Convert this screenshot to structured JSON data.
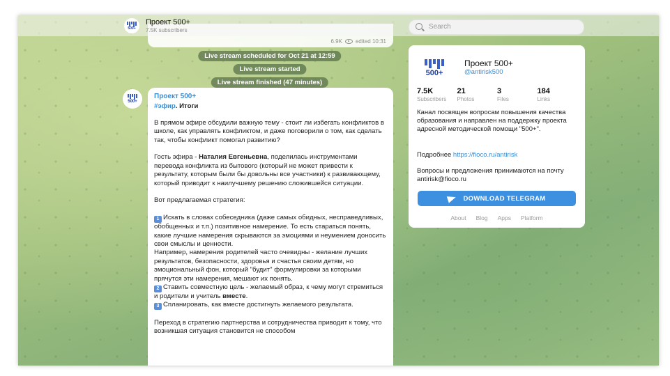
{
  "colors": {
    "accent": "#3a8dd4",
    "button": "#3d8fe0",
    "pill_bg": "#556e46"
  },
  "header": {
    "channel_title": "Проект 500+",
    "channel_subtitle": "7.5K subscribers",
    "search_placeholder": "Search"
  },
  "logo": {
    "text": "500+"
  },
  "previous_message": {
    "views": "6.9K",
    "edited": "edited 10:31"
  },
  "service_messages": [
    "Live stream scheduled for Oct 21 at 12:59",
    "Live stream started",
    "Live stream finished (47 minutes)"
  ],
  "post": {
    "author": "Проект 500+",
    "hashtag": "#эфир",
    "headline_rest": ". Итоги",
    "p1": "В прямом эфире обсудили важную тему - стоит ли избегать конфликтов в школе, как управлять конфликтом, и даже поговорили о том, как сделать так, чтобы конфликт помогал развитию?",
    "p2_pre": "Гость эфира - ",
    "p2_name": "Наталия Евгеньевна",
    "p2_post": ", поделилась инструментами перевода конфликта из бытового (который не может привести к результату, которым были бы довольны все участники) к развивающему, который приводит к наилучшему решению сложившейся ситуации.",
    "p3": "Вот предлагаемая стратегия:",
    "n1": "1",
    "s1": "Искать в словах собеседника (даже самых обидных, несправедливых, обобщенных и т.п.) позитивное намерение. То есть стараться понять, какие лучшие намерения скрываются за эмоциями и неумением доносить свои смыслы и ценности.",
    "s1b": "Например, намерения родителей часто очевидны - желание лучших результатов, безопасности, здоровья и счастья своим детям, но эмоциональный фон, который \"будит\" формулировки за которыми прячутся эти намерения, мешают их понять.",
    "n2": "2",
    "s2_pre": "Ставить совместную цель - желаемый образ, к чему могут стремиться и родители и учитель ",
    "s2_bold": "вместе",
    "s2_post": ".",
    "n3": "3",
    "s3": "Спланировать, как вместе достигнуть желаемого результата.",
    "p4": "Переход в стратегию партнерства и сотрудничества приводит к тому, что возникшая ситуация становится не способом"
  },
  "card": {
    "title": "Проект 500+",
    "handle": "@antirisk500",
    "stats": [
      {
        "value": "7.5K",
        "label": "Subscribers"
      },
      {
        "value": "21",
        "label": "Photos"
      },
      {
        "value": "3",
        "label": "Files"
      },
      {
        "value": "184",
        "label": "Links"
      }
    ],
    "description": "Канал посвящен вопросам повышения качества образования и направлен на поддержку проекта адресной методической помощи \"500+\".",
    "more_label": "Подробнее ",
    "more_link": "https://fioco.ru/antirisk",
    "contact": "Вопросы и предложения принимаются на почту antirisk@fioco.ru",
    "download_label": "DOWNLOAD TELEGRAM",
    "links": [
      "About",
      "Blog",
      "Apps",
      "Platform"
    ]
  }
}
